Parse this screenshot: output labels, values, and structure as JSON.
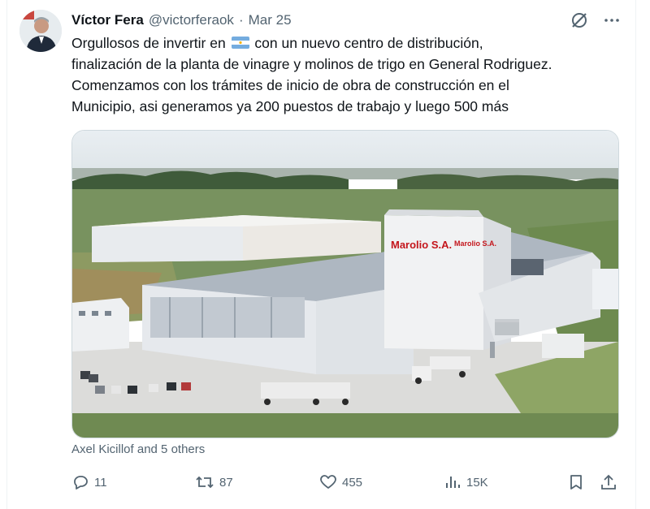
{
  "tweet": {
    "author_name": "Víctor Fera",
    "handle": "@victorferaok",
    "separator": "·",
    "date": "Mar 25",
    "text_before_flag": "Orgullosos de invertir en ",
    "flag_icon": "argentina-flag-emoji",
    "text_after_flag": " con un nuevo centro de distribución,\nfinalización de la planta de vinagre y molinos de trigo en General Rodriguez.\nComenzamos con los trámites de inicio de obra de construcción en el\nMunicipio, asi generamos ya 200 puestos de trabajo y luego 500 más",
    "media": {
      "description_icon": "aerial-factory-photo",
      "sign_main": "Marolio S.A.",
      "sign_side": "Marolio S.A."
    },
    "social_context": "Axel Kicillof and 5 others",
    "metrics": {
      "replies": "11",
      "reposts": "87",
      "likes": "455",
      "views": "15K"
    }
  },
  "icons": {
    "grok": "grok-icon",
    "more": "more-icon",
    "reply": "reply-icon",
    "repost": "repost-icon",
    "like": "heart-icon",
    "views": "views-icon",
    "bookmark": "bookmark-icon",
    "share": "share-icon"
  },
  "colors": {
    "text": "#0f1419",
    "secondary": "#536471",
    "sign_red": "#c4161c"
  }
}
